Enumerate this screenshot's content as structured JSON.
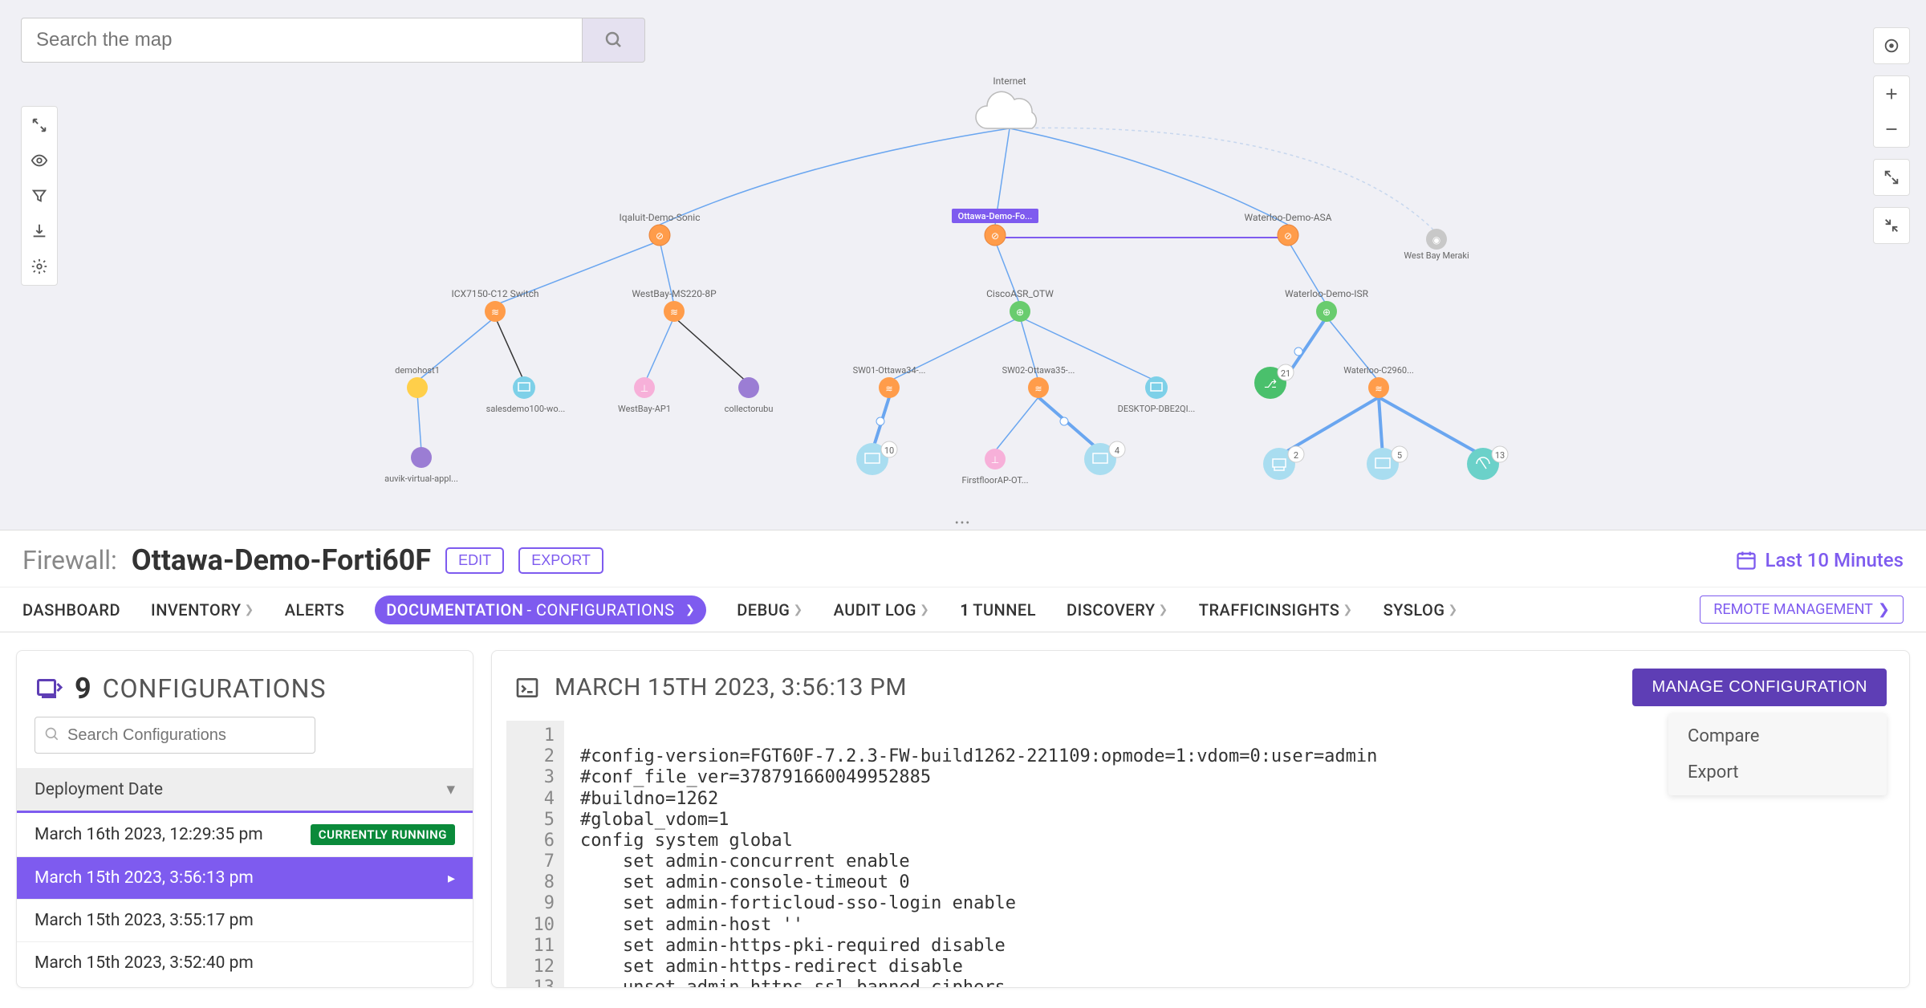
{
  "search": {
    "placeholder": "Search the map"
  },
  "topology": {
    "root": "Internet",
    "nodes": {
      "iqaluit": "Iqaluit-Demo-Sonic",
      "ottawa": "Ottawa-Demo-Fo...",
      "waterloo_asa": "Waterloo-Demo-ASA",
      "westbay_meraki": "West Bay Meraki",
      "icx": "ICX7150-C12 Switch",
      "westbay_ms": "WestBay-MS220-8P",
      "demohost": "demohost1",
      "salesdemo": "salesdemo100-wo...",
      "westbay_ap": "WestBay-AP1",
      "collector": "collectorubu",
      "auvik": "auvik-virtual-appl...",
      "cisco_asr": "CiscoASR_OTW",
      "sw01": "SW01-Ottawa34-...",
      "sw02": "SW02-Ottawa35-...",
      "desktop": "DESKTOP-DBE2QI...",
      "firstfloor": "FirstfloorAP-OT...",
      "waterloo_isr": "Waterloo-Demo-ISR",
      "waterloo_c2960": "Waterloo-C2960..."
    },
    "badges": {
      "b21": "21",
      "b10": "10",
      "b4": "4",
      "b2": "2",
      "b5": "5",
      "b13": "13"
    }
  },
  "panel": {
    "type": "Firewall:",
    "name": "Ottawa-Demo-Forti60F",
    "edit": "EDIT",
    "export": "EXPORT",
    "timerange": "Last 10 Minutes"
  },
  "tabs": {
    "dashboard": "DASHBOARD",
    "inventory": "INVENTORY",
    "alerts": "ALERTS",
    "documentation": "DOCUMENTATION",
    "configurations": " - CONFIGURATIONS",
    "debug": "DEBUG",
    "auditlog": "AUDIT LOG",
    "tunnel_num": "1",
    "tunnel": " TUNNEL",
    "discovery": "DISCOVERY",
    "traffic": "TRAFFICINSIGHTS",
    "syslog": "SYSLOG",
    "remote": "REMOTE MANAGEMENT"
  },
  "sidebar": {
    "count": "9",
    "label": "CONFIGURATIONS",
    "search_placeholder": "Search Configurations",
    "group_header": "Deployment Date",
    "items": [
      {
        "date": "March 16th 2023, 12:29:35 pm",
        "badge": "CURRENTLY RUNNING"
      },
      {
        "date": "March 15th 2023, 3:56:13 pm"
      },
      {
        "date": "March 15th 2023, 3:55:17 pm"
      },
      {
        "date": "March 15th 2023, 3:52:40 pm"
      }
    ]
  },
  "detail": {
    "timestamp": "MARCH 15TH 2023, 3:56:13 PM",
    "manage": "MANAGE CONFIGURATION",
    "menu": {
      "compare": "Compare",
      "export": "Export"
    },
    "lines": [
      "",
      "#config-version=FGT60F-7.2.3-FW-build1262-221109:opmode=1:vdom=0:user=admin",
      "#conf_file_ver=378791660049952885",
      "#buildno=1262",
      "#global_vdom=1",
      "config system global",
      "    set admin-concurrent enable",
      "    set admin-console-timeout 0",
      "    set admin-forticloud-sso-login enable",
      "    set admin-host ''",
      "    set admin-https-pki-required disable",
      "    set admin-https-redirect disable",
      "    unset admin-https-ssl-banned-ciphers"
    ]
  }
}
